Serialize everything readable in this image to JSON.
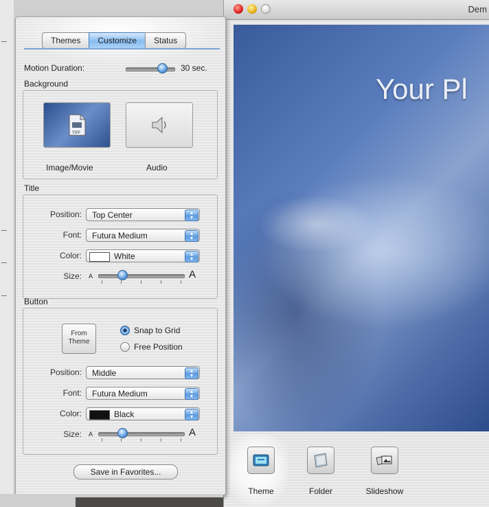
{
  "window": {
    "title": "Dem",
    "preview_title": "Your Pl"
  },
  "toolbar": {
    "items": [
      {
        "label": "Theme",
        "icon": "theme-icon"
      },
      {
        "label": "Folder",
        "icon": "folder-icon"
      },
      {
        "label": "Slideshow",
        "icon": "slideshow-icon"
      }
    ]
  },
  "drawer": {
    "tabs": [
      "Themes",
      "Customize",
      "Status"
    ],
    "active_tab": "Customize",
    "motion_duration": {
      "label": "Motion Duration:",
      "value_label": "30 sec.",
      "level": 0.75
    },
    "background": {
      "title": "Background",
      "image_label": "Image/Movie",
      "audio_label": "Audio",
      "image_badge": "TIFF"
    },
    "title_group": {
      "title": "Title",
      "position_label": "Position:",
      "position_value": "Top Center",
      "font_label": "Font:",
      "font_value": "Futura Medium",
      "color_label": "Color:",
      "color_value": "White",
      "color_hex": "#ffffff",
      "size_label": "Size:",
      "size_small": "A",
      "size_large": "A",
      "size_level": 0.28
    },
    "button_group": {
      "title": "Button",
      "from_theme_line1": "From",
      "from_theme_line2": "Theme",
      "snap_label": "Snap to Grid",
      "free_label": "Free Position",
      "position_label": "Position:",
      "position_value": "Middle",
      "font_label": "Font:",
      "font_value": "Futura Medium",
      "color_label": "Color:",
      "color_value": "Black",
      "color_hex": "#111111",
      "size_label": "Size:",
      "size_small": "A",
      "size_large": "A",
      "size_level": 0.28
    },
    "save_button": "Save in Favorites..."
  },
  "colors": {
    "accent": "#5b9be0",
    "preview_blue": "#3a5b9b"
  }
}
